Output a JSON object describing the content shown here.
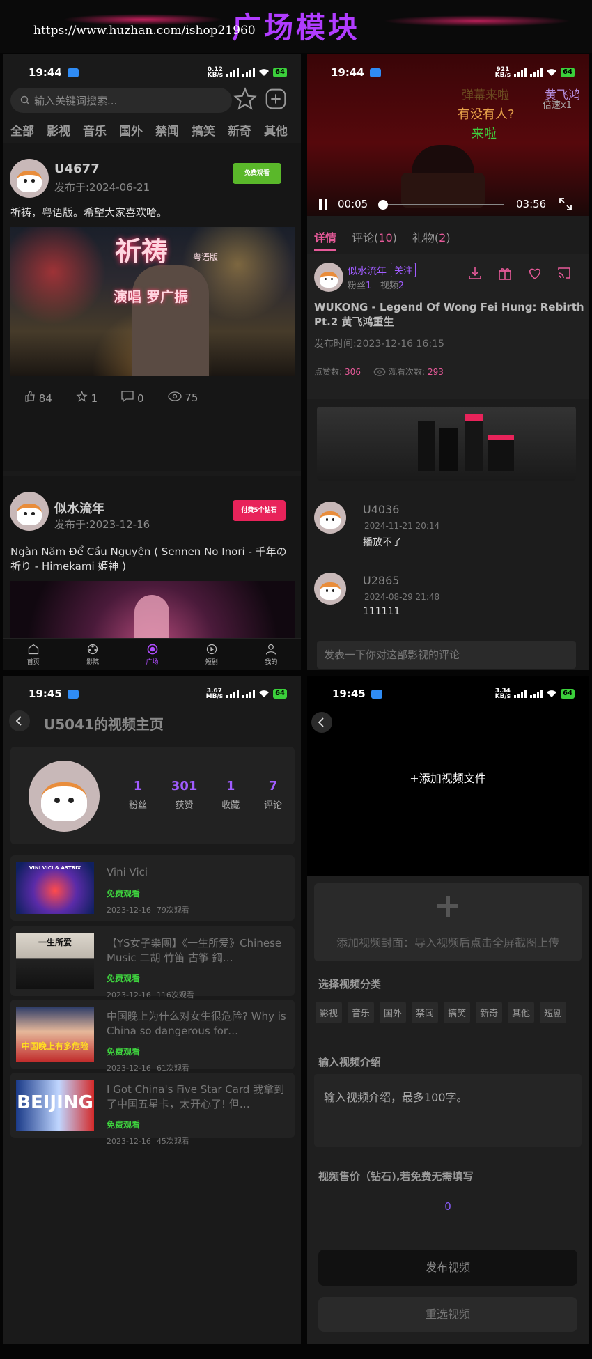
{
  "banner": {
    "title": "广场模块",
    "url": "https://www.huzhan.com/ishop21960"
  },
  "status": {
    "p1": {
      "time": "19:44",
      "speed": "0.12",
      "unit": "KB/s",
      "battery": "64"
    },
    "p2": {
      "time": "19:44",
      "speed": "921",
      "unit": "KB/s",
      "battery": "64"
    },
    "p3": {
      "time": "19:45",
      "speed": "3.67",
      "unit": "MB/s",
      "battery": "64"
    },
    "p4": {
      "time": "19:45",
      "speed": "3.34",
      "unit": "KB/s",
      "battery": "64"
    }
  },
  "feed": {
    "search_placeholder": "输入关键词搜索...",
    "categories": [
      "全部",
      "影视",
      "音乐",
      "国外",
      "禁闻",
      "搞笑",
      "新奇",
      "其他"
    ],
    "posts": [
      {
        "user": "U4677",
        "date": "发布于:2024-06-21",
        "badge": "免费观看",
        "badge_color": "#5ab82a",
        "text": "祈祷，粤语版。希望大家喜欢哈。",
        "thumb_title": "祈祷",
        "thumb_sub": "粤语版",
        "thumb_singer": "演唱 罗广振",
        "likes": "84",
        "stars": "1",
        "comments": "0",
        "views": "75"
      },
      {
        "user": "似水流年",
        "date": "发布于:2023-12-16",
        "badge": "付费5个钻石",
        "badge_color": "#e8235a",
        "text": "Ngàn Năm Để Cầu Nguyện ( Sennen No Inori - 千年の祈り - Himekami 姫神 )"
      }
    ],
    "nav": [
      {
        "label": "首页",
        "icon": "home-icon"
      },
      {
        "label": "影院",
        "icon": "film-reel-icon"
      },
      {
        "label": "广场",
        "icon": "plaza-icon",
        "active": true
      },
      {
        "label": "短剧",
        "icon": "play-circle-icon"
      },
      {
        "label": "我的",
        "icon": "user-icon"
      }
    ]
  },
  "player": {
    "danmaku": [
      "弹幕来啦",
      "有没有人?",
      "来啦"
    ],
    "danmaku_right": "黄飞鸿",
    "speed_label": "倍速x1",
    "current": "00:05",
    "duration": "03:56",
    "progress": 0.02,
    "tabs": [
      {
        "label": "详情"
      },
      {
        "label": "评论",
        "count": "10"
      },
      {
        "label": "礼物",
        "count": "2"
      }
    ],
    "author": "似水流年",
    "follow": "关注",
    "fans_label": "粉丝",
    "fans": "1",
    "videos_label": "视频",
    "videos": "2",
    "video_title": "WUKONG - Legend Of Wong Fei Hung: Rebirth Pt.2 黄飞鸿重生",
    "publish_time": "发布时间:2023-12-16 16:15",
    "likes_label": "点赞数:",
    "likes": "306",
    "views_label": "观看次数:",
    "views": "293",
    "comments": [
      {
        "user": "U4036",
        "time": "2024-11-21 20:14",
        "text": "播放不了"
      },
      {
        "user": "U2865",
        "time": "2024-08-29 21:48",
        "text": "111111"
      }
    ],
    "comment_placeholder": "发表一下你对这部影视的评论"
  },
  "profile": {
    "title": "U5041的视频主页",
    "stats": [
      {
        "value": "1",
        "label": "粉丝"
      },
      {
        "value": "301",
        "label": "获赞"
      },
      {
        "value": "1",
        "label": "收藏"
      },
      {
        "value": "7",
        "label": "评论"
      }
    ],
    "videos": [
      {
        "title": "Vini Vici",
        "badge": "免费观看",
        "date": "2023-12-16",
        "views": "79次观看",
        "thumb": "VINI VICI & ASTRIX"
      },
      {
        "title": "【YS女子樂團】《一生所爱》Chinese Music 二胡 竹笛 古筝 鋼…",
        "badge": "免费观看",
        "date": "2023-12-16",
        "views": "116次观看",
        "thumb": "一生所爱"
      },
      {
        "title": "中国晚上为什么对女生很危险? Why is China so dangerous for…",
        "badge": "免费观看",
        "date": "2023-12-16",
        "views": "61次观看",
        "thumb": "中国晚上有多危险"
      },
      {
        "title": "I Got China's Five Star Card 我拿到了中国五星卡，太开心了! 但…",
        "badge": "免费观看",
        "date": "2023-12-16",
        "views": "45次观看",
        "thumb": "BEIJING"
      }
    ]
  },
  "upload": {
    "add_video": "+添加视频文件",
    "cover_hint": "添加视频封面：导入视频后点击全屏截图上传",
    "category_title": "选择视频分类",
    "categories": [
      "影视",
      "音乐",
      "国外",
      "禁闻",
      "搞笑",
      "新奇",
      "其他",
      "短剧"
    ],
    "intro_title": "输入视频介绍",
    "intro_placeholder": "输入视频介绍，最多100字。",
    "price_title": "视频售价（钻石),若免费无需填写",
    "price_value": "0",
    "publish": "发布视频",
    "reselect": "重选视频"
  }
}
